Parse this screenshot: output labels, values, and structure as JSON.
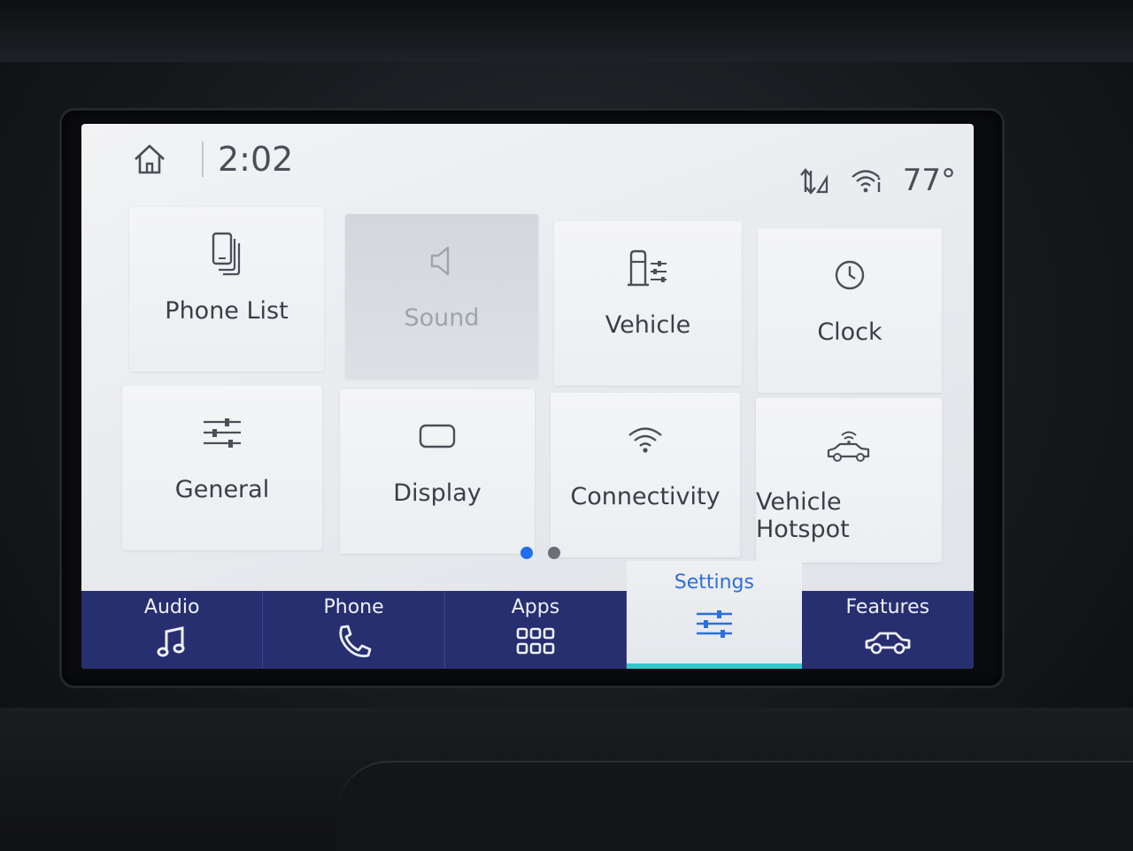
{
  "status_bar": {
    "time": "2:02",
    "temperature": "77°",
    "icons": [
      "home-icon",
      "network-signal-icon",
      "wifi-icon"
    ]
  },
  "tiles": [
    {
      "label": "Phone List",
      "icon": "phone-list-icon",
      "disabled": false
    },
    {
      "label": "Sound",
      "icon": "speaker-icon",
      "disabled": true
    },
    {
      "label": "Vehicle",
      "icon": "vehicle-settings-icon",
      "disabled": false
    },
    {
      "label": "Clock",
      "icon": "clock-icon",
      "disabled": false
    },
    {
      "label": "General",
      "icon": "sliders-icon",
      "disabled": false
    },
    {
      "label": "Display",
      "icon": "display-icon",
      "disabled": false
    },
    {
      "label": "Connectivity",
      "icon": "wifi-icon",
      "disabled": false
    },
    {
      "label": "Vehicle Hotspot",
      "icon": "vehicle-hotspot-icon",
      "disabled": false
    }
  ],
  "pagination": {
    "pages": 2,
    "current": 1
  },
  "nav": [
    {
      "label": "Audio",
      "icon": "music-note-icon",
      "active": false
    },
    {
      "label": "Phone",
      "icon": "phone-handset-icon",
      "active": false
    },
    {
      "label": "Apps",
      "icon": "apps-grid-icon",
      "active": false
    },
    {
      "label": "Settings",
      "icon": "settings-sliders-icon",
      "active": true
    },
    {
      "label": "Features",
      "icon": "car-features-icon",
      "active": false
    }
  ],
  "colors": {
    "nav_background": "#272f70",
    "active_accent": "#2b6fe0",
    "active_underline": "#33c7c9",
    "page_dot_active": "#1f6ff0"
  }
}
